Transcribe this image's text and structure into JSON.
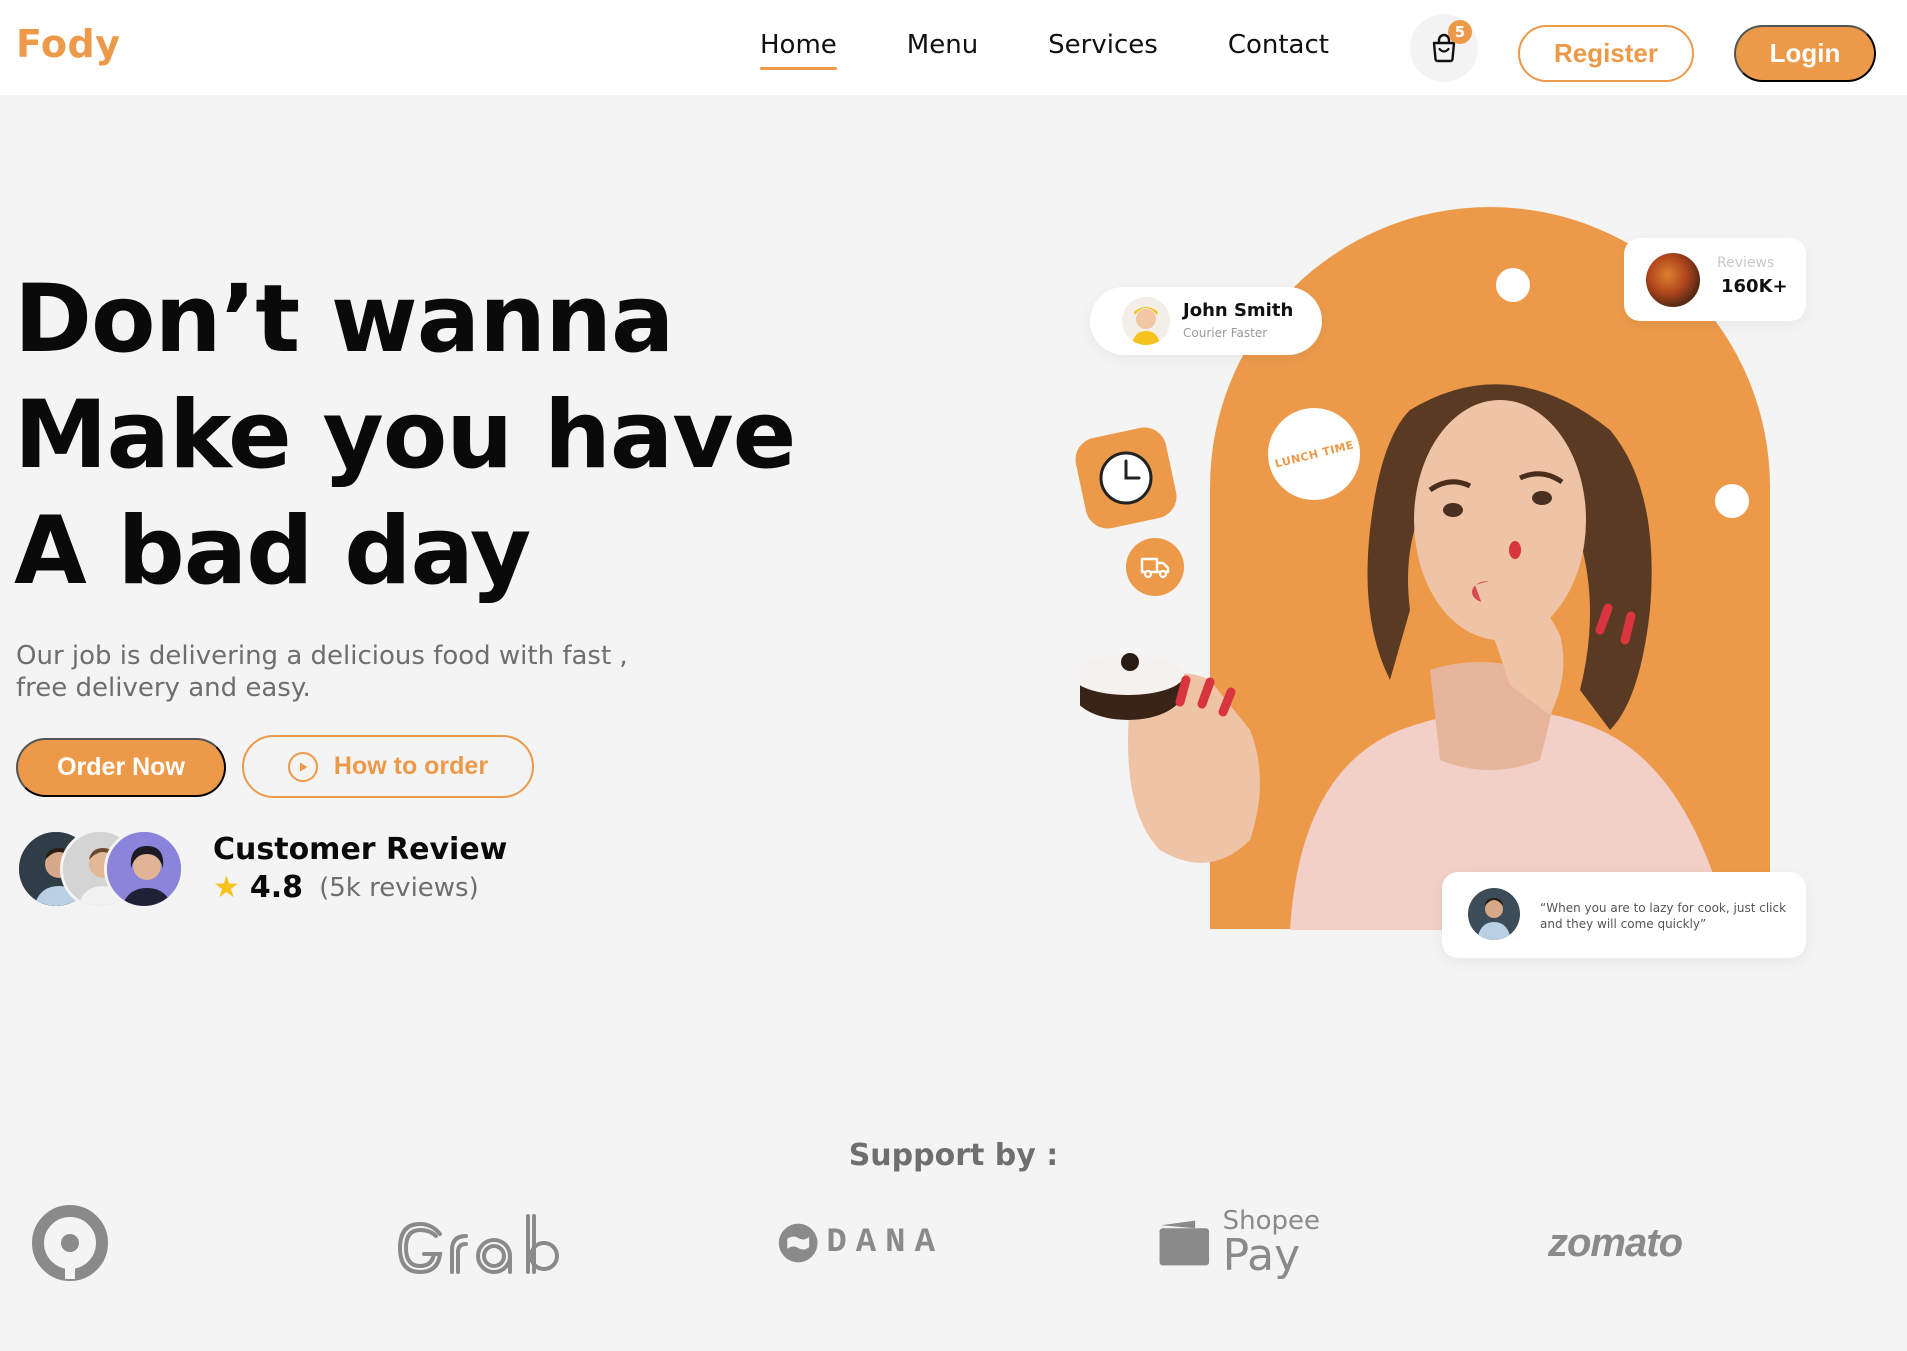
{
  "header": {
    "logo": "Fody",
    "nav": [
      {
        "label": "Home",
        "active": true
      },
      {
        "label": "Menu",
        "active": false
      },
      {
        "label": "Services",
        "active": false
      },
      {
        "label": "Contact",
        "active": false
      }
    ],
    "cart_count": "5",
    "register_label": "Register",
    "login_label": "Login"
  },
  "hero": {
    "title_lines": [
      "Don’t wanna",
      "Make you have",
      "A bad day"
    ],
    "subtitle_lines": [
      "Our job is delivering a delicious food with fast ,",
      "free delivery and easy."
    ],
    "order_button": "Order Now",
    "how_button": "How to order",
    "review_title": "Customer Review",
    "rating": "4.8",
    "review_count": "(5k reviews)"
  },
  "visual": {
    "courier_name": "John Smith",
    "courier_role": "Courier Faster",
    "reviews_label": "Reviews",
    "reviews_value": "160K+",
    "lunch_badge": "LUNCH TIME",
    "quote": "“When you are to lazy for cook, just click and they will come quickly”"
  },
  "support": {
    "title": "Support by :",
    "partners": [
      "Gojek",
      "Grab",
      "DANA",
      "Shopee Pay",
      "zomato"
    ],
    "dana_text": "DANA",
    "shopee_top": "Shopee",
    "shopee_bottom": "Pay",
    "zomato_text": "zomato"
  },
  "colors": {
    "accent": "#ec9a4a",
    "background": "#f4f4f4",
    "star": "#f6c31c",
    "partner_gray": "#8a8a8a"
  }
}
